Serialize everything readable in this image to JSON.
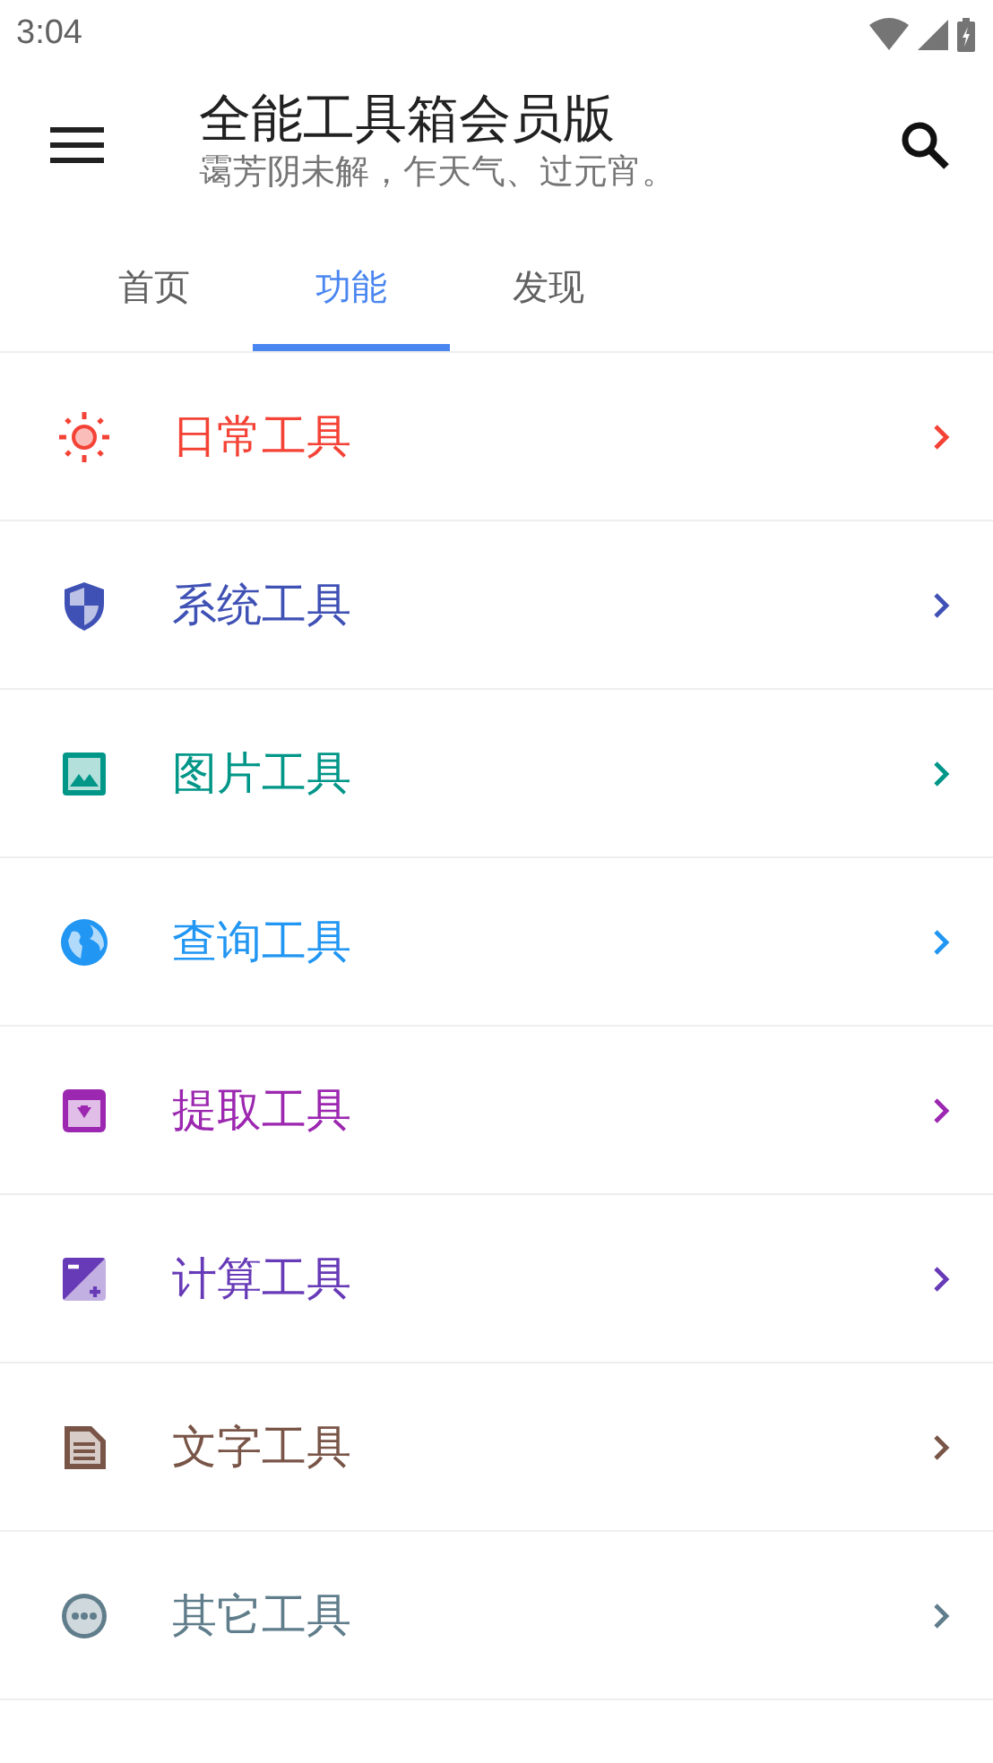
{
  "status_bar": {
    "time": "3:04"
  },
  "toolbar": {
    "title": "全能工具箱会员版",
    "subtitle": "霭芳阴未解，乍天气、过元宵。"
  },
  "tabs": [
    {
      "label": "首页",
      "selected": false
    },
    {
      "label": "功能",
      "selected": true
    },
    {
      "label": "发现",
      "selected": false
    }
  ],
  "categories": [
    {
      "kind": "sun",
      "label": "日常工具",
      "color": "#f44336"
    },
    {
      "kind": "shield",
      "label": "系统工具",
      "color": "#3f51b5"
    },
    {
      "kind": "image",
      "label": "图片工具",
      "color": "#009688"
    },
    {
      "kind": "globe",
      "label": "查询工具",
      "color": "#2196f3"
    },
    {
      "kind": "archive",
      "label": "提取工具",
      "color": "#9c27b0"
    },
    {
      "kind": "calc",
      "label": "计算工具",
      "color": "#673ab7"
    },
    {
      "kind": "doc",
      "label": "文字工具",
      "color": "#795548"
    },
    {
      "kind": "more",
      "label": "其它工具",
      "color": "#607d8b"
    }
  ]
}
